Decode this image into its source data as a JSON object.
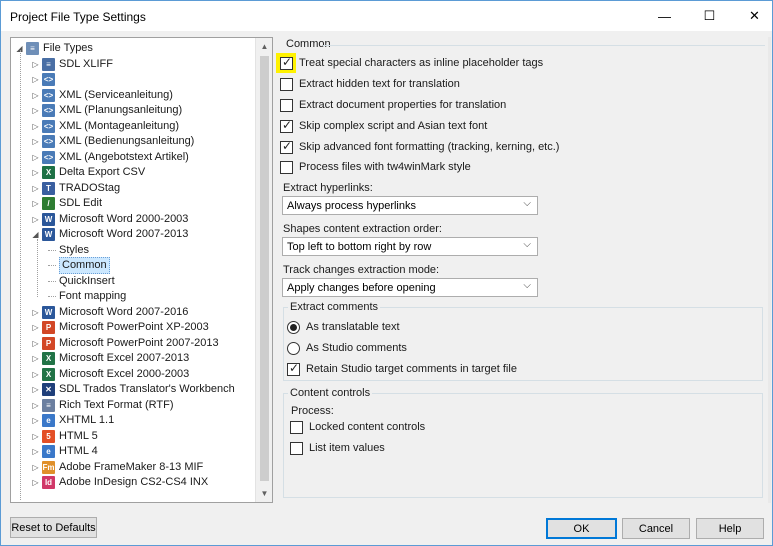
{
  "window": {
    "title": "Project File Type Settings",
    "min_glyph": "—",
    "max_glyph": "☐",
    "close_glyph": "✕"
  },
  "tree": {
    "items": [
      {
        "label": "File Types",
        "icon": "file-types-icon",
        "icon_color": "#6f8fb8",
        "icon_glyph": "≡",
        "expander": "◢"
      },
      {
        "label": "SDL XLIFF",
        "icon": "xliff-icon",
        "icon_color": "#4a6fa5",
        "icon_glyph": "≡",
        "expander": "▷"
      },
      {
        "label": "",
        "icon": "xml-icon",
        "icon_color": "#4a7bb7",
        "icon_glyph": "<>",
        "expander": "▷"
      },
      {
        "label": "XML (Serviceanleitung)",
        "icon": "xml-icon",
        "icon_color": "#4a7bb7",
        "icon_glyph": "<>",
        "expander": "▷"
      },
      {
        "label": "XML (Planungsanleitung)",
        "icon": "xml-icon",
        "icon_color": "#4a7bb7",
        "icon_glyph": "<>",
        "expander": "▷"
      },
      {
        "label": "XML (Montageanleitung)",
        "icon": "xml-icon",
        "icon_color": "#4a7bb7",
        "icon_glyph": "<>",
        "expander": "▷"
      },
      {
        "label": "XML (Bedienungsanleitung)",
        "icon": "xml-icon",
        "icon_color": "#4a7bb7",
        "icon_glyph": "<>",
        "expander": "▷"
      },
      {
        "label": "XML (Angebotstext Artikel)",
        "icon": "xml-icon",
        "icon_color": "#4a7bb7",
        "icon_glyph": "<>",
        "expander": "▷"
      },
      {
        "label": "Delta Export CSV",
        "icon": "csv-icon",
        "icon_color": "#1e7145",
        "icon_glyph": "X",
        "expander": "▷"
      },
      {
        "label": "TRADOStag",
        "icon": "tradostag-icon",
        "icon_color": "#3a5fa0",
        "icon_glyph": "T",
        "expander": "▷"
      },
      {
        "label": "SDL Edit",
        "icon": "sdl-edit-icon",
        "icon_color": "#2e7d32",
        "icon_glyph": "/",
        "expander": "▷"
      },
      {
        "label": "Microsoft Word 2000-2003",
        "icon": "word-icon",
        "icon_color": "#2b579a",
        "icon_glyph": "W",
        "expander": "▷"
      },
      {
        "label": "Microsoft Word 2007-2013",
        "icon": "word-icon",
        "icon_color": "#2b579a",
        "icon_glyph": "W",
        "expander": "◢"
      },
      {
        "label": "Styles",
        "icon": "",
        "expander": ""
      },
      {
        "label": "Common",
        "icon": "",
        "expander": "",
        "selected": true
      },
      {
        "label": "QuickInsert",
        "icon": "",
        "expander": ""
      },
      {
        "label": "Font mapping",
        "icon": "",
        "expander": ""
      },
      {
        "label": "Microsoft Word 2007-2016",
        "icon": "word-icon",
        "icon_color": "#2b579a",
        "icon_glyph": "W",
        "expander": "▷"
      },
      {
        "label": "Microsoft PowerPoint XP-2003",
        "icon": "powerpoint-icon",
        "icon_color": "#d24726",
        "icon_glyph": "P",
        "expander": "▷"
      },
      {
        "label": "Microsoft PowerPoint 2007-2013",
        "icon": "powerpoint-icon",
        "icon_color": "#d24726",
        "icon_glyph": "P",
        "expander": "▷"
      },
      {
        "label": "Microsoft Excel 2007-2013",
        "icon": "excel-icon",
        "icon_color": "#217346",
        "icon_glyph": "X",
        "expander": "▷"
      },
      {
        "label": "Microsoft Excel 2000-2003",
        "icon": "excel-icon",
        "icon_color": "#217346",
        "icon_glyph": "X",
        "expander": "▷"
      },
      {
        "label": "SDL Trados Translator's Workbench",
        "icon": "workbench-icon",
        "icon_color": "#1f3f7a",
        "icon_glyph": "✕",
        "expander": "▷"
      },
      {
        "label": "Rich Text Format (RTF)",
        "icon": "rtf-icon",
        "icon_color": "#6b7fa0",
        "icon_glyph": "≡",
        "expander": "▷"
      },
      {
        "label": "XHTML 1.1",
        "icon": "xhtml-icon",
        "icon_color": "#3a78c9",
        "icon_glyph": "e",
        "expander": "▷"
      },
      {
        "label": "HTML 5",
        "icon": "html5-icon",
        "icon_color": "#e34f26",
        "icon_glyph": "5",
        "expander": "▷"
      },
      {
        "label": "HTML 4",
        "icon": "html4-icon",
        "icon_color": "#3a78c9",
        "icon_glyph": "e",
        "expander": "▷"
      },
      {
        "label": "Adobe FrameMaker 8-13 MIF",
        "icon": "framemaker-icon",
        "icon_color": "#e0902a",
        "icon_glyph": "Fm",
        "expander": "▷"
      },
      {
        "label": "Adobe InDesign CS2-CS4 INX",
        "icon": "indesign-icon",
        "icon_color": "#d03868",
        "icon_glyph": "Id",
        "expander": "▷"
      }
    ],
    "scroll_up": "▲",
    "scroll_down": "▼",
    "scroll_position_fraction": 0.0
  },
  "common": {
    "header": "Common",
    "checkboxes": [
      {
        "label": "Treat special characters as inline placeholder tags",
        "checked": true,
        "highlighted": true
      },
      {
        "label": "Extract hidden text for translation",
        "checked": false
      },
      {
        "label": "Extract document properties for translation",
        "checked": false
      },
      {
        "label": "Skip complex script and Asian text font",
        "checked": true
      },
      {
        "label": "Skip advanced font formatting (tracking, kerning, etc.)",
        "checked": true
      },
      {
        "label": "Process files with tw4winMark style",
        "checked": false
      }
    ],
    "hyperlinks": {
      "label": "Extract hyperlinks:",
      "value": "Always process hyperlinks"
    },
    "shapes": {
      "label": "Shapes content extraction order:",
      "value": "Top left to bottom right by row"
    },
    "track_changes": {
      "label": "Track changes extraction mode:",
      "value": "Apply changes before opening"
    },
    "chevron": "⌵"
  },
  "extract_comments": {
    "header": "Extract comments",
    "radios": [
      {
        "label": "As translatable text",
        "selected": true
      },
      {
        "label": "As Studio comments",
        "selected": false
      }
    ],
    "retain": {
      "label": "Retain Studio target comments in target file",
      "checked": true
    }
  },
  "content_controls": {
    "header": "Content controls",
    "process_label": "Process:",
    "checkboxes": [
      {
        "label": "Locked content controls",
        "checked": false
      },
      {
        "label": "List item values",
        "checked": false
      }
    ]
  },
  "buttons": {
    "reset": "Reset to Defaults",
    "ok": "OK",
    "cancel": "Cancel",
    "help": "Help"
  },
  "colors": {
    "highlight": "#fff200",
    "selection": "#cce8ff",
    "default_button_border": "#0078d7"
  }
}
